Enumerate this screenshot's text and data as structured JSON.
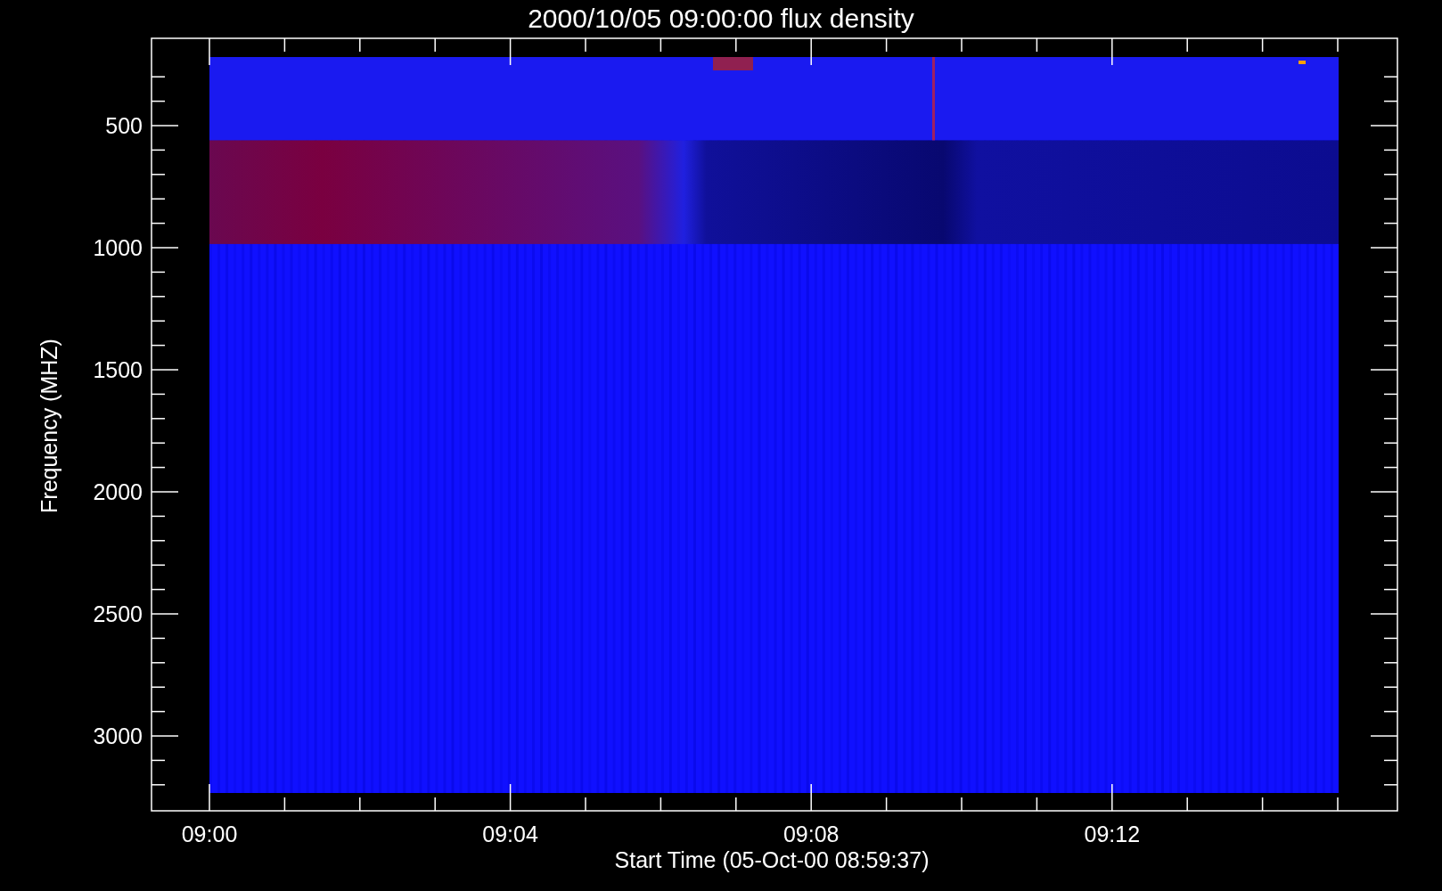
{
  "plot": {
    "title": "2000/10/05 09:00:00 flux density",
    "ylabel": "Frequency (MHZ)",
    "xlabel": "Start Time (05-Oct-00 08:59:37)",
    "yticks": [
      "500",
      "1000",
      "1500",
      "2000",
      "2500",
      "3000"
    ],
    "xticks": [
      "09:00",
      "09:04",
      "09:08",
      "09:12"
    ]
  }
}
